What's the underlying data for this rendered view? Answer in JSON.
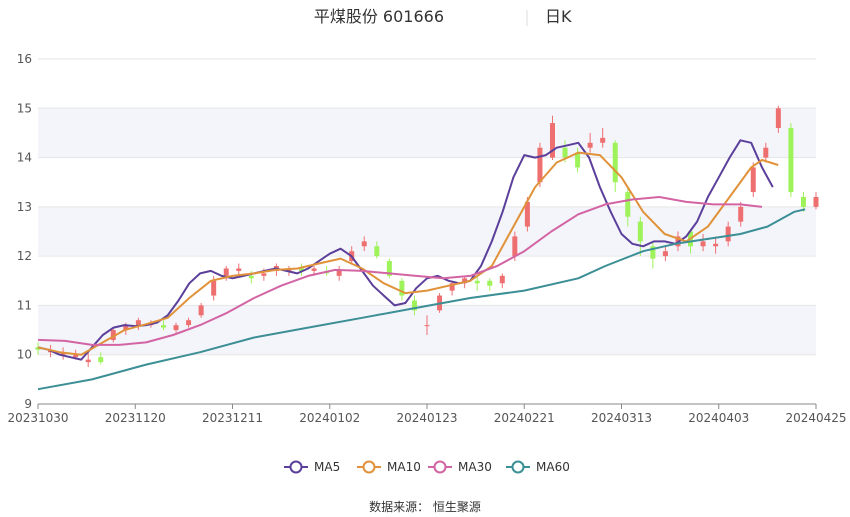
{
  "title": {
    "name": "平煤股份 601666",
    "period": "日K"
  },
  "source": "数据来源： 恒生聚源",
  "chart_data": {
    "type": "candlestick",
    "title": "平煤股份 601666",
    "period": "日K",
    "y_ticks": [
      9,
      10,
      11,
      12,
      13,
      14,
      15,
      16
    ],
    "ylim": [
      9,
      16
    ],
    "x_ticks": [
      "20231030",
      "20231120",
      "20231211",
      "20240102",
      "20240123",
      "20240221",
      "20240313",
      "20240403",
      "20240425"
    ],
    "x_tick_index": [
      0,
      15,
      30,
      45,
      60,
      75,
      90,
      105,
      120
    ],
    "trading_days": 121,
    "up_color": "#ee6f6f",
    "down_color": "#9ef25a",
    "legend_position": "bottom",
    "grid": true,
    "series": [
      {
        "name": "MA5",
        "color": "#5b3f9a",
        "points": [
          [
            0,
            10.15
          ],
          [
            2,
            10.1
          ],
          [
            4,
            10.0
          ],
          [
            6,
            9.95
          ],
          [
            8,
            9.9
          ],
          [
            10,
            10.15
          ],
          [
            12,
            10.4
          ],
          [
            14,
            10.55
          ],
          [
            16,
            10.6
          ],
          [
            18,
            10.58
          ],
          [
            20,
            10.6
          ],
          [
            22,
            10.65
          ],
          [
            24,
            10.8
          ],
          [
            26,
            11.1
          ],
          [
            28,
            11.45
          ],
          [
            30,
            11.65
          ],
          [
            32,
            11.7
          ],
          [
            34,
            11.6
          ],
          [
            36,
            11.55
          ],
          [
            38,
            11.6
          ],
          [
            40,
            11.65
          ],
          [
            42,
            11.7
          ],
          [
            44,
            11.75
          ],
          [
            46,
            11.7
          ],
          [
            48,
            11.65
          ],
          [
            50,
            11.75
          ],
          [
            52,
            11.9
          ],
          [
            54,
            12.05
          ],
          [
            56,
            12.15
          ],
          [
            58,
            12.0
          ],
          [
            60,
            11.7
          ],
          [
            62,
            11.4
          ],
          [
            64,
            11.2
          ],
          [
            66,
            11.0
          ],
          [
            68,
            11.05
          ],
          [
            70,
            11.35
          ],
          [
            72,
            11.55
          ],
          [
            74,
            11.6
          ],
          [
            76,
            11.5
          ],
          [
            78,
            11.45
          ],
          [
            80,
            11.5
          ],
          [
            82,
            11.8
          ],
          [
            84,
            12.3
          ],
          [
            86,
            12.9
          ],
          [
            88,
            13.6
          ],
          [
            90,
            14.05
          ],
          [
            92,
            14.0
          ],
          [
            94,
            14.05
          ],
          [
            96,
            14.2
          ],
          [
            98,
            14.25
          ],
          [
            100,
            14.3
          ],
          [
            102,
            14.0
          ],
          [
            104,
            13.4
          ],
          [
            106,
            12.9
          ],
          [
            108,
            12.45
          ],
          [
            110,
            12.25
          ],
          [
            112,
            12.2
          ],
          [
            114,
            12.3
          ],
          [
            116,
            12.3
          ],
          [
            118,
            12.25
          ],
          [
            120,
            12.4
          ],
          [
            122,
            12.7
          ],
          [
            124,
            13.2
          ],
          [
            126,
            13.6
          ],
          [
            128,
            14.0
          ],
          [
            130,
            14.35
          ],
          [
            132,
            14.3
          ],
          [
            134,
            13.8
          ],
          [
            136,
            13.4
          ]
        ]
      },
      {
        "name": "MA10",
        "color": "#e0923a",
        "points": [
          [
            0,
            10.15
          ],
          [
            4,
            10.05
          ],
          [
            8,
            10.0
          ],
          [
            12,
            10.25
          ],
          [
            16,
            10.5
          ],
          [
            20,
            10.62
          ],
          [
            24,
            10.75
          ],
          [
            28,
            11.15
          ],
          [
            32,
            11.5
          ],
          [
            36,
            11.6
          ],
          [
            40,
            11.65
          ],
          [
            44,
            11.72
          ],
          [
            48,
            11.75
          ],
          [
            52,
            11.85
          ],
          [
            56,
            11.95
          ],
          [
            60,
            11.75
          ],
          [
            64,
            11.45
          ],
          [
            68,
            11.25
          ],
          [
            72,
            11.3
          ],
          [
            76,
            11.4
          ],
          [
            80,
            11.5
          ],
          [
            84,
            11.8
          ],
          [
            88,
            12.6
          ],
          [
            92,
            13.4
          ],
          [
            96,
            13.9
          ],
          [
            100,
            14.1
          ],
          [
            104,
            14.05
          ],
          [
            108,
            13.6
          ],
          [
            112,
            12.9
          ],
          [
            116,
            12.45
          ],
          [
            120,
            12.3
          ],
          [
            124,
            12.6
          ],
          [
            128,
            13.2
          ],
          [
            132,
            13.8
          ],
          [
            134,
            13.95
          ],
          [
            137,
            13.85
          ]
        ]
      },
      {
        "name": "MA30",
        "color": "#d364a4",
        "points": [
          [
            0,
            10.3
          ],
          [
            5,
            10.28
          ],
          [
            10,
            10.2
          ],
          [
            15,
            10.2
          ],
          [
            20,
            10.25
          ],
          [
            25,
            10.4
          ],
          [
            30,
            10.6
          ],
          [
            35,
            10.85
          ],
          [
            40,
            11.15
          ],
          [
            45,
            11.4
          ],
          [
            50,
            11.6
          ],
          [
            55,
            11.72
          ],
          [
            60,
            11.7
          ],
          [
            65,
            11.65
          ],
          [
            70,
            11.6
          ],
          [
            75,
            11.55
          ],
          [
            80,
            11.6
          ],
          [
            85,
            11.8
          ],
          [
            90,
            12.1
          ],
          [
            95,
            12.5
          ],
          [
            100,
            12.85
          ],
          [
            105,
            13.05
          ],
          [
            110,
            13.15
          ],
          [
            115,
            13.2
          ],
          [
            120,
            13.1
          ],
          [
            125,
            13.05
          ],
          [
            130,
            13.05
          ],
          [
            134,
            13.0
          ]
        ]
      },
      {
        "name": "MA60",
        "color": "#3b8f95",
        "points": [
          [
            0,
            9.3
          ],
          [
            10,
            9.5
          ],
          [
            20,
            9.8
          ],
          [
            30,
            10.05
          ],
          [
            40,
            10.35
          ],
          [
            50,
            10.55
          ],
          [
            60,
            10.75
          ],
          [
            70,
            10.95
          ],
          [
            80,
            11.15
          ],
          [
            90,
            11.3
          ],
          [
            100,
            11.55
          ],
          [
            105,
            11.8
          ],
          [
            112,
            12.1
          ],
          [
            118,
            12.25
          ],
          [
            124,
            12.35
          ],
          [
            130,
            12.45
          ],
          [
            135,
            12.6
          ],
          [
            140,
            12.9
          ],
          [
            142,
            12.95
          ]
        ]
      }
    ],
    "candles": [
      [
        0,
        10.15,
        10.1,
        10.25,
        10.0
      ],
      [
        1,
        10.05,
        10.1,
        10.2,
        9.95
      ],
      [
        2,
        10.0,
        10.05,
        10.15,
        9.9
      ],
      [
        3,
        9.95,
        10.0,
        10.1,
        9.9
      ],
      [
        4,
        9.85,
        9.9,
        10.05,
        9.75
      ],
      [
        5,
        9.95,
        9.85,
        10.05,
        9.8
      ],
      [
        6,
        10.3,
        10.5,
        10.55,
        10.25
      ],
      [
        7,
        10.5,
        10.6,
        10.65,
        10.4
      ],
      [
        8,
        10.6,
        10.7,
        10.75,
        10.5
      ],
      [
        9,
        10.6,
        10.65,
        10.7,
        10.55
      ],
      [
        10,
        10.6,
        10.55,
        10.7,
        10.5
      ],
      [
        11,
        10.5,
        10.6,
        10.65,
        10.45
      ],
      [
        12,
        10.6,
        10.7,
        10.75,
        10.55
      ],
      [
        13,
        10.8,
        11.0,
        11.05,
        10.75
      ],
      [
        14,
        11.2,
        11.5,
        11.6,
        11.1
      ],
      [
        15,
        11.6,
        11.75,
        11.8,
        11.5
      ],
      [
        16,
        11.7,
        11.75,
        11.85,
        11.6
      ],
      [
        17,
        11.6,
        11.55,
        11.7,
        11.45
      ],
      [
        18,
        11.6,
        11.65,
        11.75,
        11.5
      ],
      [
        19,
        11.7,
        11.8,
        11.85,
        11.6
      ],
      [
        20,
        11.7,
        11.75,
        11.8,
        11.6
      ],
      [
        21,
        11.75,
        11.7,
        11.85,
        11.6
      ],
      [
        22,
        11.7,
        11.75,
        11.8,
        11.6
      ],
      [
        23,
        11.7,
        11.65,
        11.8,
        11.6
      ],
      [
        24,
        11.6,
        11.7,
        11.8,
        11.5
      ],
      [
        25,
        11.9,
        12.1,
        12.2,
        11.85
      ],
      [
        26,
        12.2,
        12.3,
        12.4,
        12.1
      ],
      [
        27,
        12.2,
        12.0,
        12.3,
        11.95
      ],
      [
        28,
        11.9,
        11.6,
        11.95,
        11.55
      ],
      [
        29,
        11.5,
        11.2,
        11.55,
        11.1
      ],
      [
        30,
        11.1,
        10.9,
        11.2,
        10.8
      ],
      [
        31,
        10.6,
        10.6,
        10.8,
        10.4
      ],
      [
        32,
        10.9,
        11.2,
        11.25,
        10.85
      ],
      [
        33,
        11.3,
        11.45,
        11.5,
        11.2
      ],
      [
        34,
        11.45,
        11.55,
        11.6,
        11.35
      ],
      [
        35,
        11.5,
        11.45,
        11.6,
        11.3
      ],
      [
        36,
        11.5,
        11.4,
        11.55,
        11.3
      ],
      [
        37,
        11.45,
        11.6,
        11.65,
        11.35
      ],
      [
        38,
        12.0,
        12.4,
        12.5,
        11.9
      ],
      [
        39,
        12.6,
        13.1,
        13.2,
        12.5
      ],
      [
        40,
        13.5,
        14.2,
        14.3,
        13.4
      ],
      [
        41,
        14.0,
        14.7,
        14.85,
        13.95
      ],
      [
        42,
        14.2,
        14.0,
        14.35,
        13.9
      ],
      [
        43,
        14.1,
        13.8,
        14.2,
        13.7
      ],
      [
        44,
        14.2,
        14.3,
        14.5,
        14.1
      ],
      [
        45,
        14.3,
        14.4,
        14.6,
        14.2
      ],
      [
        46,
        14.3,
        13.5,
        14.35,
        13.3
      ],
      [
        47,
        13.3,
        12.8,
        13.4,
        12.6
      ],
      [
        48,
        12.7,
        12.3,
        12.8,
        12.0
      ],
      [
        49,
        12.2,
        11.95,
        12.3,
        11.75
      ],
      [
        50,
        12.0,
        12.1,
        12.2,
        11.9
      ],
      [
        51,
        12.2,
        12.4,
        12.5,
        12.1
      ],
      [
        52,
        12.5,
        12.2,
        12.55,
        12.05
      ],
      [
        53,
        12.2,
        12.3,
        12.45,
        12.1
      ],
      [
        54,
        12.2,
        12.25,
        12.4,
        12.05
      ],
      [
        55,
        12.3,
        12.6,
        12.7,
        12.2
      ],
      [
        56,
        12.7,
        13.0,
        13.1,
        12.6
      ],
      [
        57,
        13.3,
        13.8,
        13.9,
        13.2
      ],
      [
        58,
        14.0,
        14.2,
        14.3,
        13.9
      ],
      [
        59,
        14.6,
        15.0,
        15.05,
        14.5
      ],
      [
        60,
        14.6,
        13.3,
        14.7,
        13.2
      ],
      [
        61,
        13.2,
        13.0,
        13.3,
        12.9
      ],
      [
        62,
        13.0,
        13.2,
        13.3,
        12.95
      ]
    ]
  },
  "legend": [
    {
      "label": "MA5",
      "color": "#5b3f9a"
    },
    {
      "label": "MA10",
      "color": "#e0923a"
    },
    {
      "label": "MA30",
      "color": "#d364a4"
    },
    {
      "label": "MA60",
      "color": "#3b8f95"
    }
  ]
}
